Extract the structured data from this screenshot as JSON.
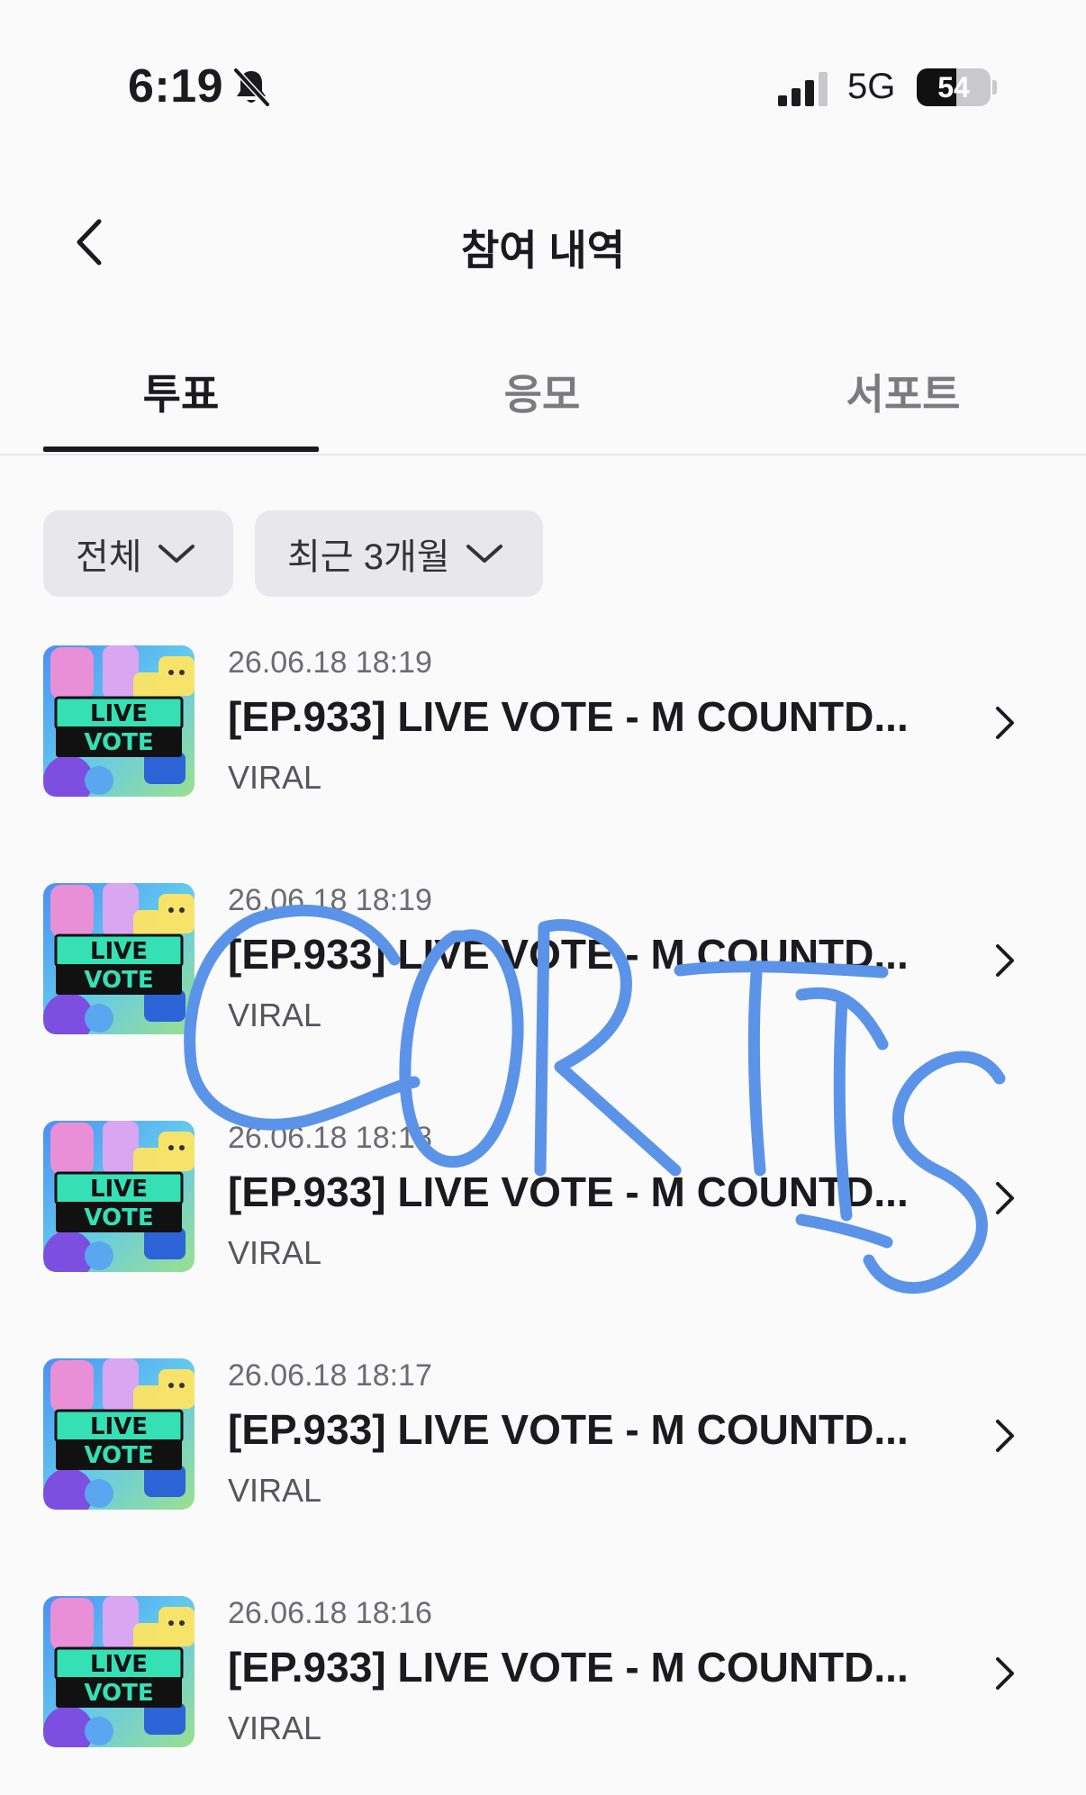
{
  "status_bar": {
    "time": "6:19",
    "network": "5G",
    "battery": "54",
    "battery_level": 0.54
  },
  "header": {
    "title": "참여 내역"
  },
  "tabs": [
    {
      "label": "투표",
      "active": true
    },
    {
      "label": "응모",
      "active": false
    },
    {
      "label": "서포트",
      "active": false
    }
  ],
  "filters": {
    "category": "전체",
    "period": "최근 3개월"
  },
  "items": [
    {
      "date": "26.06.18 18:19",
      "title": "[EP.933] LIVE VOTE - M COUNTD...",
      "sub": "VIRAL"
    },
    {
      "date": "26.06.18 18:19",
      "title": "[EP.933] LIVE VOTE - M COUNTD...",
      "sub": "VIRAL"
    },
    {
      "date": "26.06.18 18:18",
      "title": "[EP.933] LIVE VOTE - M COUNTD...",
      "sub": "VIRAL"
    },
    {
      "date": "26.06.18 18:17",
      "title": "[EP.933] LIVE VOTE - M COUNTD...",
      "sub": "VIRAL"
    },
    {
      "date": "26.06.18 18:16",
      "title": "[EP.933] LIVE VOTE - M COUNTD...",
      "sub": "VIRAL"
    }
  ],
  "thumbnail": {
    "line1": "LIVE",
    "line2": "VOTE"
  },
  "handwriting": "CORTIS",
  "colors": {
    "background": "#fafafa",
    "chip": "#e8e8ec",
    "scribble": "#5b93e8",
    "text_primary": "#1b1b1f",
    "text_secondary": "#6b6b70"
  }
}
